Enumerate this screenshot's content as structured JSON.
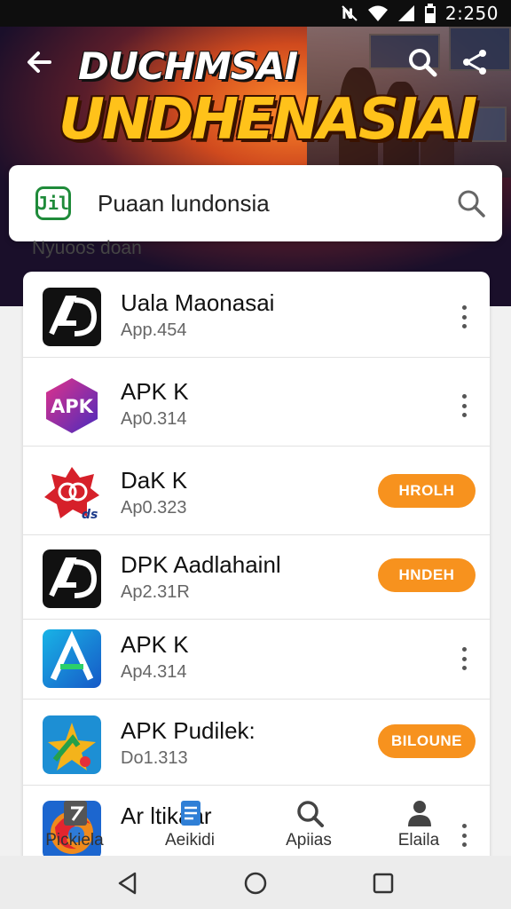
{
  "status_bar": {
    "time": "2:250",
    "icons": [
      "nfc-icon",
      "wifi-icon",
      "signal-icon",
      "battery-icon"
    ]
  },
  "banner": {
    "title_line1": "DUCHMSAI",
    "title_line2": "UNDHENASIAI",
    "icons": [
      "back-arrow-icon",
      "search-icon",
      "share-icon"
    ]
  },
  "search": {
    "logo_text": "Jil",
    "query": "Puaan lundonsia",
    "icon": "search-icon"
  },
  "section": {
    "label": "Nyuoos doan"
  },
  "apps": [
    {
      "name": "Uala Maonasai",
      "sub": "App.454",
      "action": "menu",
      "action_label": "",
      "icon": "ad-logo-icon"
    },
    {
      "name": "APK K",
      "sub": "Ap0.314",
      "action": "menu",
      "action_label": "",
      "icon": "apk-hexagon-icon"
    },
    {
      "name": "DaK K",
      "sub": "Ap0.323",
      "action": "button",
      "action_label": "HROLH",
      "icon": "red-badge-icon"
    },
    {
      "name": "DPK Aadlahainl",
      "sub": "Ap2.31R",
      "action": "button",
      "action_label": "HNDEH",
      "icon": "ad-logo-icon"
    },
    {
      "name": "APK K",
      "sub": "Ap4.314",
      "action": "menu",
      "action_label": "",
      "icon": "a-letter-icon"
    },
    {
      "name": "APK Pudilek:",
      "sub": "Do1.313",
      "action": "button",
      "action_label": "BILOUNE",
      "icon": "star-arrow-icon"
    },
    {
      "name": "Ar ltikaar",
      "sub": "",
      "action": "menu",
      "action_label": "",
      "icon": "swirl-icon"
    }
  ],
  "bottom_nav": [
    {
      "label": "Pickiela",
      "icon": "tablet-icon"
    },
    {
      "label": "Aeikidi",
      "icon": "document-icon"
    },
    {
      "label": "Apiias",
      "icon": "search-icon"
    },
    {
      "label": "Elaila",
      "icon": "person-icon"
    }
  ],
  "system_nav": {
    "icons": [
      "back-triangle-icon",
      "home-circle-icon",
      "recents-square-icon"
    ]
  },
  "colors": {
    "accent_orange": "#f7921e",
    "title_yellow": "#ffc21a",
    "logo_green": "#1f8b3a"
  }
}
